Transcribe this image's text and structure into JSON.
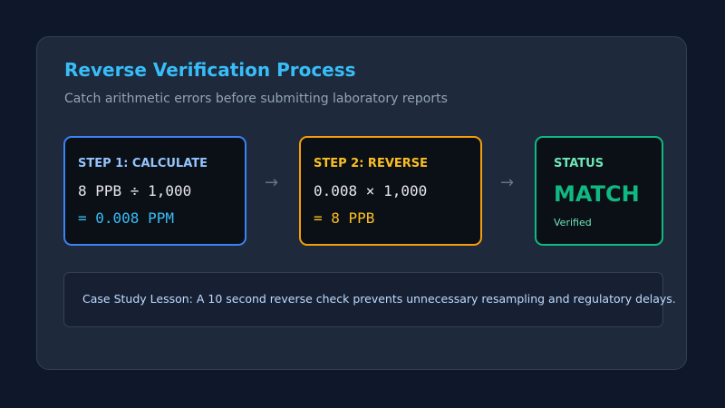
{
  "header": {
    "title": "Reverse Verification Process",
    "subtitle": "Catch arithmetic errors before submitting laboratory reports"
  },
  "steps": [
    {
      "label": "STEP 1: CALCULATE",
      "expression": "8 PPB ÷ 1,000",
      "result": "= 0.008 PPM",
      "accent": "#3b82f6"
    },
    {
      "label": "STEP 2: REVERSE",
      "expression": "0.008 × 1,000",
      "result": "= 8 PPB",
      "accent": "#f59e0b"
    }
  ],
  "status": {
    "label": "STATUS",
    "value": "MATCH",
    "note": "Verified",
    "accent": "#10b981"
  },
  "arrows": [
    "→",
    "→"
  ],
  "lesson": {
    "text": "Case Study Lesson: A 10 second reverse check prevents unnecessary resampling and regulatory delays."
  }
}
